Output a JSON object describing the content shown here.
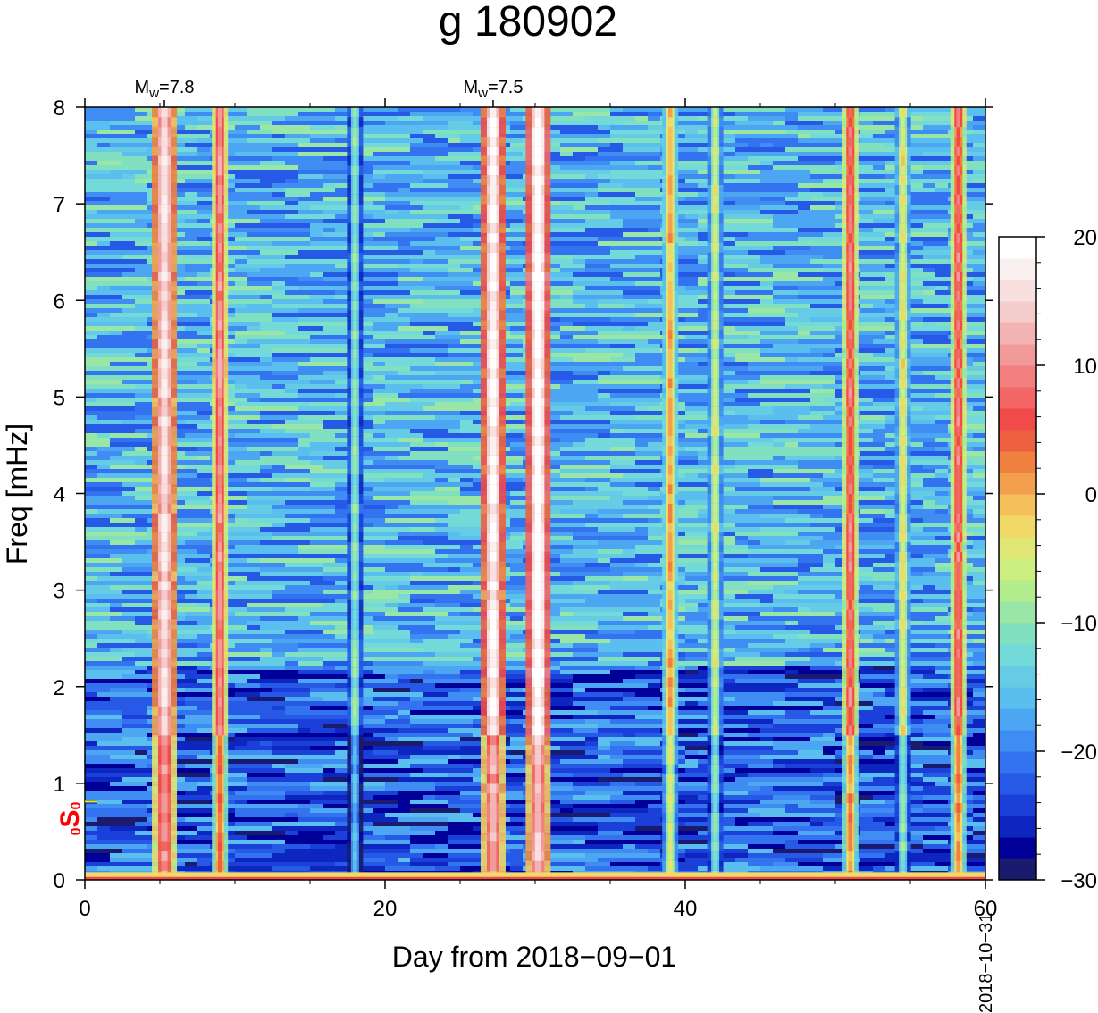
{
  "chart_data": {
    "type": "heatmap",
    "title": "g 180902",
    "xlabel": "Day from 2018−09−01",
    "ylabel": "Freq [mHz]",
    "xlim": [
      0,
      60
    ],
    "ylim": [
      0,
      8
    ],
    "x_ticks": [
      0,
      20,
      40,
      60
    ],
    "x_tick_labels": [
      "0",
      "20",
      "40",
      "60"
    ],
    "y_ticks": [
      0,
      1,
      2,
      3,
      4,
      5,
      6,
      7,
      8
    ],
    "y_tick_labels": [
      "0",
      "1",
      "2",
      "3",
      "4",
      "5",
      "6",
      "7",
      "8"
    ],
    "end_date_label": "2018−10−31",
    "colorbar": {
      "range": [
        -30,
        20
      ],
      "ticks": [
        20,
        10,
        0,
        -10,
        -20,
        -30
      ],
      "tick_labels": [
        "20",
        "10",
        "0",
        "−10",
        "−20",
        "−30"
      ],
      "colors": [
        "#1a1a6e",
        "#000099",
        "#0d26bf",
        "#1a40d9",
        "#2659e6",
        "#3373f0",
        "#3f8cf2",
        "#4da6f2",
        "#5abfee",
        "#66cce6",
        "#73d9d9",
        "#80e0bf",
        "#99e6a6",
        "#b3ec8c",
        "#cced80",
        "#e0e673",
        "#f0d966",
        "#f5bf5a",
        "#f2a04d",
        "#ef8040",
        "#ec6040",
        "#f04a4a",
        "#f26666",
        "#f28080",
        "#f29999",
        "#f2b3b3",
        "#f5cccc",
        "#f8e0e0",
        "#fbf0f0",
        "#ffffff"
      ]
    },
    "events": [
      {
        "day": 5.3,
        "label": "M",
        "sub": "w",
        "value": "=7.8"
      },
      {
        "day": 27.2,
        "label": "M",
        "sub": "w",
        "value": "=7.5"
      }
    ],
    "mode_marker": {
      "freq": 0.81,
      "prefix": "0",
      "label": "S",
      "sub": "0",
      "color": "#ff0000"
    },
    "vertical_bands": [
      {
        "day": 5.3,
        "fmax": 8,
        "level": 16
      },
      {
        "day": 9.0,
        "fmax": 8,
        "level": 10
      },
      {
        "day": 18.0,
        "fmax": 8,
        "level": -10
      },
      {
        "day": 27.2,
        "fmax": 8,
        "level": 18
      },
      {
        "day": 30.2,
        "fmax": 8,
        "level": 20
      },
      {
        "day": 39.0,
        "fmax": 8,
        "level": 0
      },
      {
        "day": 42.0,
        "fmax": 8,
        "level": -5
      },
      {
        "day": 51.0,
        "fmax": 8,
        "level": 8
      },
      {
        "day": 54.5,
        "fmax": 8,
        "level": -4
      },
      {
        "day": 58.2,
        "fmax": 8,
        "level": 8
      }
    ]
  }
}
